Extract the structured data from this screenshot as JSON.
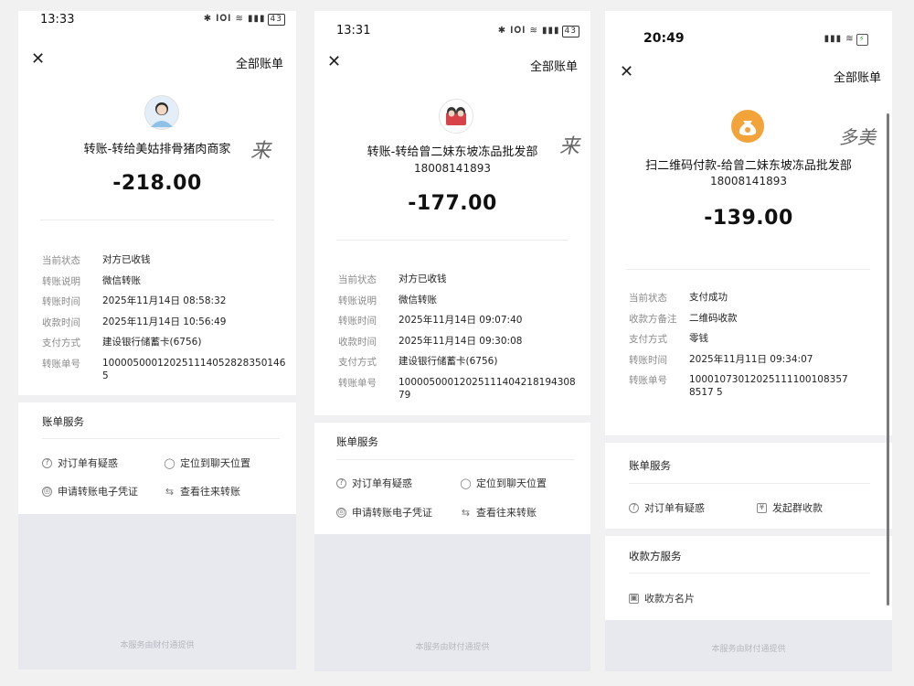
{
  "common": {
    "all_bills": "全部账单",
    "bill_service": "账单服务",
    "close_icon": "close-icon",
    "footer": "本服务由财付通提供"
  },
  "p1": {
    "time": "13:33",
    "status_icons": "✱ 𝐈𝐎𝐈 ≋ ▮▮▮",
    "battery": "43",
    "title": "转账-转给美姑排骨猪肉商家",
    "amount": "-218.00",
    "signature": "来",
    "details": [
      {
        "k": "当前状态",
        "v": "对方已收钱"
      },
      {
        "k": "转账说明",
        "v": "微信转账"
      },
      {
        "k": "转账时间",
        "v": "2025年11月14日 08:58:32"
      },
      {
        "k": "收款时间",
        "v": "2025年11月14日 10:56:49"
      },
      {
        "k": "支付方式",
        "v": "建设银行储蓄卡(6756)"
      },
      {
        "k": "转账单号",
        "v": "1000050001202511140528283501465"
      }
    ],
    "svc_question": "对订单有疑惑",
    "svc_locate": "定位到聊天位置",
    "svc_voucher": "申请转账电子凭证",
    "svc_history": "查看往来转账"
  },
  "p2": {
    "time": "13:31",
    "status_icons": "✱ 𝐈𝐎𝐈 ≋ ▮▮▮",
    "battery": "43",
    "title": "转账-转给曾二妹东坡冻品批发部",
    "phone": "18008141893",
    "amount": "-177.00",
    "signature": "来",
    "details": [
      {
        "k": "当前状态",
        "v": "对方已收钱"
      },
      {
        "k": "转账说明",
        "v": "微信转账"
      },
      {
        "k": "转账时间",
        "v": "2025年11月14日 09:07:40"
      },
      {
        "k": "收款时间",
        "v": "2025年11月14日 09:30:08"
      },
      {
        "k": "支付方式",
        "v": "建设银行储蓄卡(6756)"
      },
      {
        "k": "转账单号",
        "v": "1000050001202511140421819430879"
      }
    ],
    "svc_question": "对订单有疑惑",
    "svc_locate": "定位到聊天位置",
    "svc_voucher": "申请转账电子凭证",
    "svc_history": "查看往来转账"
  },
  "p3": {
    "time": "20:49",
    "status_icons": "▮▮▮ ≋",
    "battery": "⚡",
    "title": "扫二维码付款-给曾二妹东坡冻品批发部",
    "phone": "18008141893",
    "amount": "-139.00",
    "signature": "多美",
    "details": [
      {
        "k": "当前状态",
        "v": "支付成功"
      },
      {
        "k": "收款方备注",
        "v": "二维码收款"
      },
      {
        "k": "支付方式",
        "v": "零钱"
      },
      {
        "k": "转账时间",
        "v": "2025年11月11日 09:34:07"
      },
      {
        "k": "转账单号",
        "v": "100010730120251111001083578517 5"
      }
    ],
    "svc_question": "对订单有疑惑",
    "svc_group": "发起群收款",
    "payee_service": "收款方服务",
    "payee_card": "收款方名片",
    "accent": "#f2a33a"
  }
}
